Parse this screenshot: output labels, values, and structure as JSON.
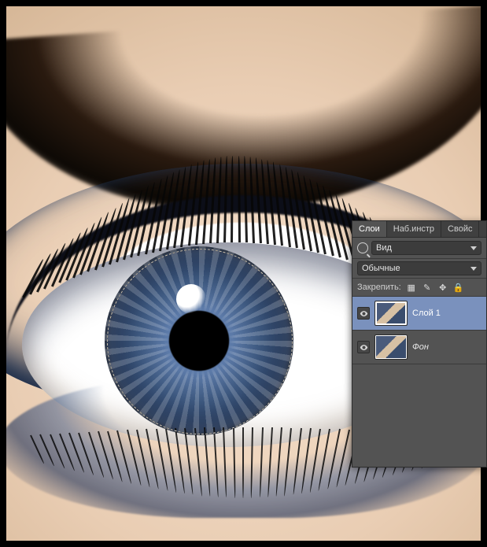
{
  "tabs": {
    "layers": "Слои",
    "adjustments": "Наб.инстр",
    "properties": "Свойс"
  },
  "filter": {
    "label": "Вид"
  },
  "blend": {
    "mode": "Обычные"
  },
  "lock": {
    "label": "Закрепить:"
  },
  "layers": [
    {
      "name": "Слой 1",
      "visible": true,
      "selected": true
    },
    {
      "name": "Фон",
      "visible": true,
      "selected": false
    }
  ],
  "icons": {
    "pixels": "▦",
    "brush": "✎",
    "move": "✥",
    "lock": "🔒"
  }
}
